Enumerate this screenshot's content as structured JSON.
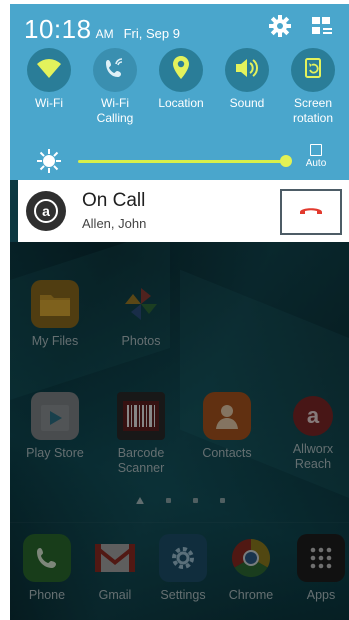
{
  "status_bar": {
    "time": "10:18",
    "ampm": "AM",
    "date": "Fri, Sep 9",
    "icons": [
      "gear-icon",
      "edit-tiles-icon"
    ]
  },
  "quick_settings": {
    "tiles": [
      {
        "label": "Wi-Fi",
        "icon": "wifi-icon",
        "state": "on"
      },
      {
        "label": "Wi-Fi\nCalling",
        "icon": "wifi-calling-icon",
        "state": "off"
      },
      {
        "label": "Location",
        "icon": "location-icon",
        "state": "on"
      },
      {
        "label": "Sound",
        "icon": "sound-icon",
        "state": "on"
      },
      {
        "label": "Screen\nrotation",
        "icon": "screen-rotation-icon",
        "state": "on"
      }
    ],
    "brightness": {
      "level": 1.0,
      "auto_label": "Auto"
    }
  },
  "notification": {
    "title": "On Call",
    "subtitle": "Allen, John",
    "action_icon": "hang-up-icon",
    "accent": "#e23a2e"
  },
  "home": {
    "apps": [
      {
        "name": "My Files"
      },
      {
        "name": "Photos"
      },
      {
        "name": "Play Store"
      },
      {
        "name": "Barcode\nScanner"
      },
      {
        "name": "Contacts"
      },
      {
        "name": "Allworx\nReach"
      }
    ],
    "dock": [
      {
        "name": "Phone"
      },
      {
        "name": "Gmail"
      },
      {
        "name": "Settings"
      },
      {
        "name": "Chrome"
      },
      {
        "name": "Apps"
      }
    ]
  },
  "colors": {
    "panel": "#4aa6cc",
    "slider": "#d8ef4a",
    "wallpaper": "#0c3b44"
  }
}
